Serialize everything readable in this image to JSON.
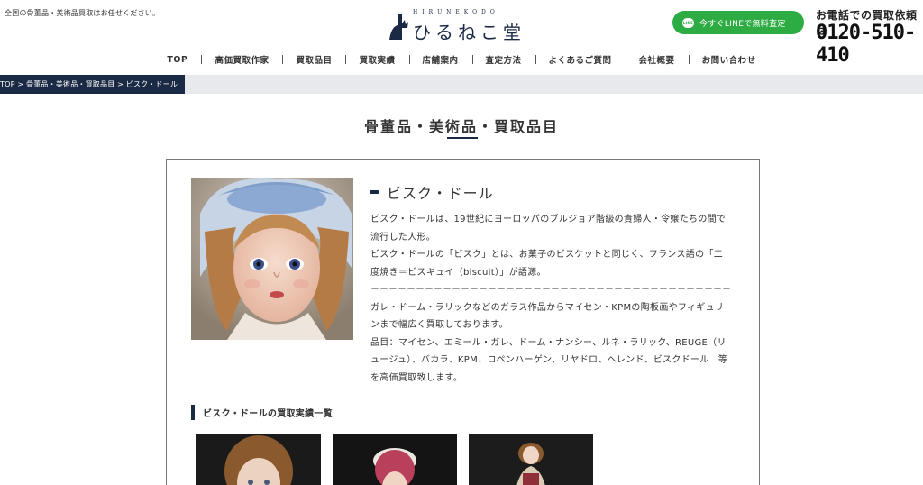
{
  "header": {
    "tagline": "全国の骨董品・美術品買取はお任せください。",
    "logo_sub": "HIRUNEKODO",
    "logo_name": "ひるねこ堂",
    "line_button_label": "今すぐLINEで無料査定",
    "line_icon_text": "LINE",
    "phone_label": "お電話での買取依頼は",
    "phone_number": "0120-510-410"
  },
  "nav": {
    "items": [
      {
        "label": "TOP"
      },
      {
        "label": "高価買取作家"
      },
      {
        "label": "買取品目"
      },
      {
        "label": "買取実績"
      },
      {
        "label": "店舗案内"
      },
      {
        "label": "査定方法"
      },
      {
        "label": "よくあるご質問"
      },
      {
        "label": "会社概要"
      },
      {
        "label": "お問い合わせ"
      }
    ]
  },
  "breadcrumb": {
    "text": "TOP > 骨董品・美術品・買取品目 > ビスク・ドール"
  },
  "page": {
    "title": "骨董品・美術品・買取品目"
  },
  "item": {
    "heading": "ビスク・ドール",
    "para1": "ビスク・ドールは、19世紀にヨーロッパのブルジョア階級の貴婦人・令嬢たちの間で流行した人形。",
    "para2": "ビスク・ドールの「ビスク」とは、お菓子のビスケットと同じく、フランス語の「二度焼き＝ビスキュイ（biscuit）」が語源。",
    "divider": "－－－－－－－－－－－－－－－－－－－－－－－－－－－－－－－－－－－－－－－－－",
    "para3": "ガレ・ドーム・ラリックなどのガラス作品からマイセン・KPMの陶板画やフィギュリンまで幅広く買取しております。",
    "para4": "品目：マイセン、エミール・ガレ、ドーム・ナンシー、ルネ・ラリック、REUGE（リュージュ）、バカラ、KPM、コペンハーゲン、リヤドロ、ヘレンド、ビスクドール　等を高価買取致します。"
  },
  "results": {
    "heading": "ビスク・ドールの買取実績一覧"
  },
  "colors": {
    "navy": "#1b2a44",
    "line_green": "#2eac44",
    "breadcrumb_bg": "#e7e9ec"
  }
}
